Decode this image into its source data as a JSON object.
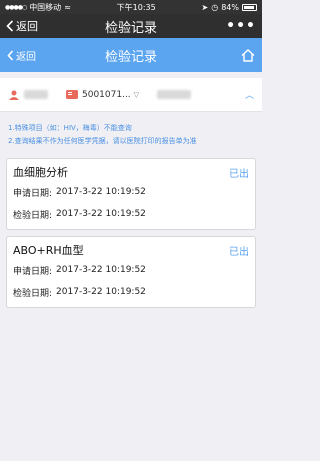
{
  "status_bar": {
    "carrier": "中国移动",
    "time": "下午10:35",
    "battery": "84%"
  },
  "wechat_nav": {
    "back_label": "返回",
    "title": "检验记录",
    "more": "•••"
  },
  "app_header": {
    "back_label": "返回",
    "title": "检验记录"
  },
  "patient": {
    "card_number": "5001071..."
  },
  "notes": [
    "1.特殊项目（如：HIV，梅毒）不能查询",
    "2.查询结果不作为任何医学凭据，请以医院打印的报告单为准"
  ],
  "records": [
    {
      "name": "血细胞分析",
      "status": "已出",
      "apply_label": "申请日期:",
      "apply_date": "2017-3-22 10:19:52",
      "test_label": "检验日期:",
      "test_date": "2017-3-22 10:19:52"
    },
    {
      "name": "ABO+RH血型",
      "status": "已出",
      "apply_label": "申请日期:",
      "apply_date": "2017-3-22 10:19:52",
      "test_label": "检验日期:",
      "test_date": "2017-3-22 10:19:52"
    }
  ],
  "colors": {
    "accent": "#5aa4f0",
    "note": "#4a90e2",
    "card_icon": "#e86a5c"
  }
}
